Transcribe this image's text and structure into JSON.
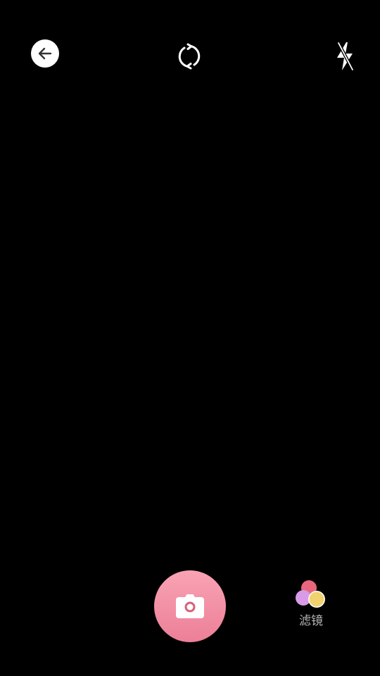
{
  "topbar": {
    "back_icon": "arrow-left-icon",
    "flip_icon": "camera-flip-icon",
    "flash_icon": "flash-off-icon"
  },
  "viewfinder": {
    "background": "#000000"
  },
  "bottombar": {
    "shutter_icon": "camera-icon",
    "shutter_color": "#f27f98",
    "filter_label": "滤镜",
    "filter_icon": "color-circles-icon",
    "filter_colors": [
      "#e8677f",
      "#d99be8",
      "#f2d26f"
    ]
  }
}
